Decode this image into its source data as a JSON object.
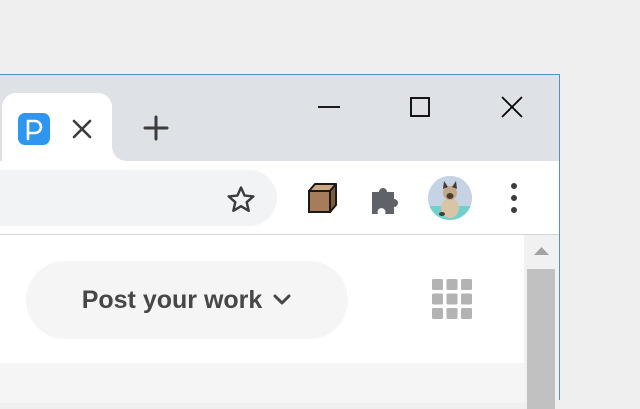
{
  "tab": {
    "favicon_letter": "P",
    "favicon_color": "#2e96ef",
    "close_icon": "close-icon"
  },
  "tabstrip": {
    "new_tab_icon": "plus-icon"
  },
  "window_controls": [
    "minimize-icon",
    "maximize-icon",
    "close-icon"
  ],
  "toolbar": {
    "bookmark_icon": "star-outline-icon",
    "extensions": [
      "box-extension-icon",
      "puzzle-extensions-icon"
    ],
    "profile": "cat-avatar",
    "menu_icon": "kebab-menu-icon"
  },
  "page": {
    "post_button_label": "Post your work",
    "post_button_icon": "chevron-down-icon",
    "apps_icon": "grid-icon"
  }
}
